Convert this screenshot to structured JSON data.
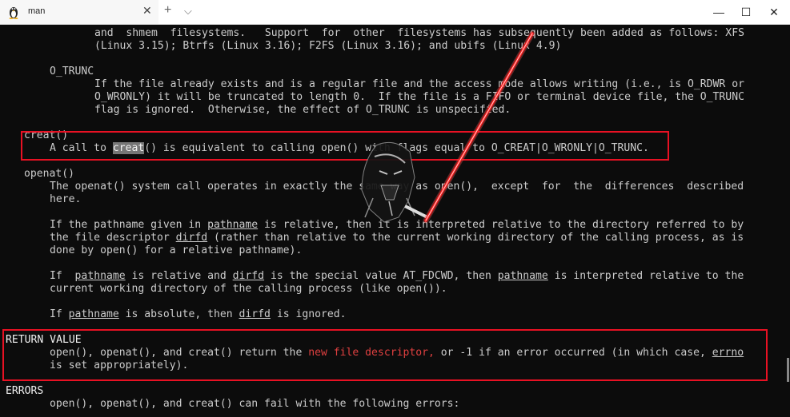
{
  "window": {
    "tab_title": "man",
    "tab_close": "✕",
    "new_tab": "+",
    "tab_menu": "⌵",
    "minimize": "—",
    "maximize": "☐",
    "close": "✕"
  },
  "terminal": {
    "l01": "and  shmem  filesystems.   Support  for  other  filesystems has subsequently been added as follows: XFS",
    "l02": "(Linux 3.15); Btrfs (Linux 3.16); F2FS (Linux 3.16); and ubifs (Linux 4.9)",
    "l03": "O_TRUNC",
    "l04": "If the file already exists and is a regular file and the access mode allows writing (i.e., is O_RDWR or",
    "l05": "O_WRONLY) it will be truncated to length 0.  If the file is a FIFO or terminal device file, the O_TRUNC",
    "l06": "flag is ignored.  Otherwise, the effect of O_TRUNC is unspecified.",
    "l07": "creat()",
    "l08a": "A call to ",
    "l08b": "creat",
    "l08c": "() is equivalent to calling open() with flags equal to O_CREAT|O_WRONLY|O_TRUNC.",
    "l09": "openat()",
    "l10": "The openat() system call operates in exactly the same way as open(),  except  for  the  differences  described",
    "l11": "here.",
    "l12a": "If the pathname given in ",
    "l12b": "pathname",
    "l12c": " is relative, then it is interpreted relative to the directory referred to by",
    "l13a": "the file descriptor ",
    "l13b": "dirfd",
    "l13c": " (rather than relative to the current working directory of the calling process, as is",
    "l14": "done by open() for a relative pathname).",
    "l15a": "If  ",
    "l15b": "pathname",
    "l15c": " is relative and ",
    "l15d": "dirfd",
    "l15e": " is the special value AT_FDCWD, then ",
    "l15f": "pathname",
    "l15g": " is interpreted relative to the",
    "l16": "current working directory of the calling process (like open()).",
    "l17a": "If ",
    "l17b": "pathname",
    "l17c": " is absolute, then ",
    "l17d": "dirfd",
    "l17e": " is ignored.",
    "l18": "RETURN VALUE",
    "l19a": "open(), openat(), and creat() return the ",
    "l19b": "new file descriptor,",
    "l19c": " or -1 if an error occurred (in which case, ",
    "l19d": "errno",
    "l20": "is set appropriately).",
    "l21": "ERRORS",
    "l22": "open(), openat(), and creat() can fail with the following errors:"
  },
  "colors": {
    "background": "#0c0c0c",
    "text": "#cccccc",
    "annotation_box": "#e81123",
    "annotation_line": "#ff2020",
    "search_highlight": "#767676"
  }
}
